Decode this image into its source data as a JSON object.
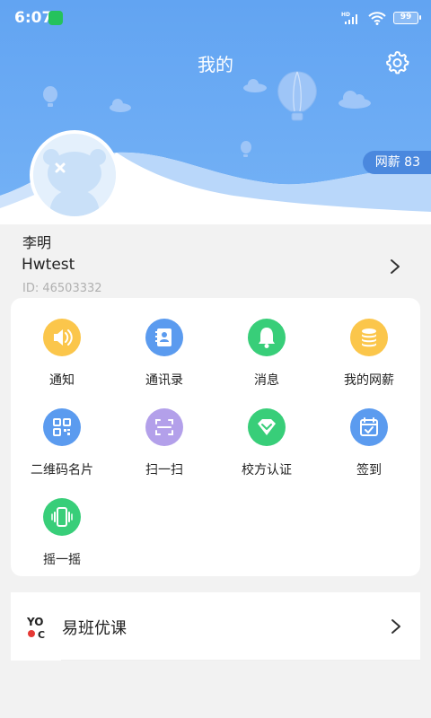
{
  "status_bar": {
    "time": "6:07",
    "network_label": "HD",
    "battery_level": "99"
  },
  "header": {
    "title": "我的",
    "salary_badge": "网薪 83"
  },
  "profile": {
    "name": "李明",
    "org": "Hwtest",
    "id_label": "ID: 46503332"
  },
  "menu": {
    "items": [
      {
        "label": "通知",
        "icon": "speaker-icon",
        "color": "#fbc64b"
      },
      {
        "label": "通讯录",
        "icon": "contacts-icon",
        "color": "#5b9bef"
      },
      {
        "label": "消息",
        "icon": "bell-icon",
        "color": "#38ce79"
      },
      {
        "label": "我的网薪",
        "icon": "coins-icon",
        "color": "#fbc64b"
      },
      {
        "label": "二维码名片",
        "icon": "qrcode-icon",
        "color": "#5b9bef"
      },
      {
        "label": "扫一扫",
        "icon": "scan-icon",
        "color": "#b3a0ea"
      },
      {
        "label": "校方认证",
        "icon": "diamond-icon",
        "color": "#38ce79"
      },
      {
        "label": "签到",
        "icon": "calendar-check-icon",
        "color": "#5b9bef"
      },
      {
        "label": "摇一摇",
        "icon": "shake-phone-icon",
        "color": "#38ce79"
      }
    ]
  },
  "course": {
    "logo_text": "YOC",
    "title": "易班优课"
  },
  "colors": {
    "header_blue": "#6aaaf3",
    "accent_blue": "#4a88de",
    "page_bg": "#f2f2f2"
  }
}
